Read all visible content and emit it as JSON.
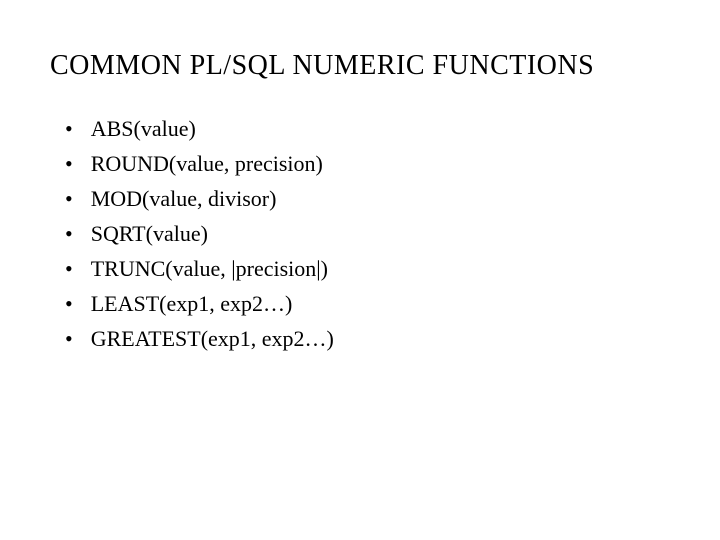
{
  "title": "COMMON  PL/SQL NUMERIC FUNCTIONS",
  "items": [
    "ABS(value)",
    "ROUND(value, precision)",
    "MOD(value, divisor)",
    "SQRT(value)",
    "TRUNC(value, |precision|)",
    "LEAST(exp1, exp2…)",
    "GREATEST(exp1, exp2…)"
  ]
}
